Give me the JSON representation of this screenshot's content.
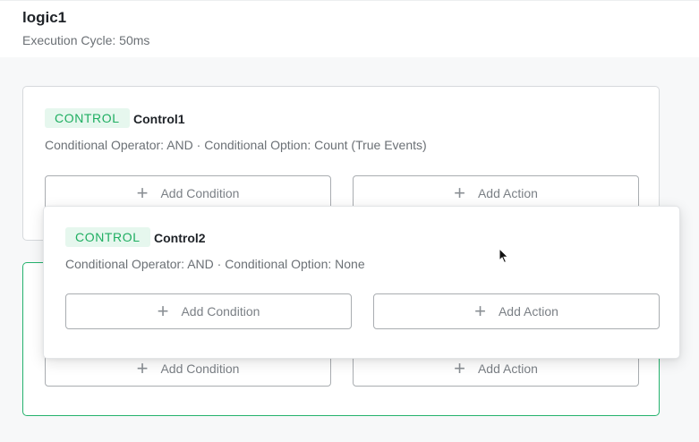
{
  "header": {
    "title": "logic1",
    "subtitle": "Execution Cycle: 50ms"
  },
  "controls": [
    {
      "tag": "CONTROL",
      "name": "Control1",
      "info": "Conditional Operator: AND · Conditional Option: Count (True Events)",
      "add_condition": "Add Condition",
      "add_action": "Add Action"
    },
    {
      "tag": "CONTROL",
      "name": "Control2",
      "info": "Conditional Operator: AND · Conditional Option: None",
      "add_condition": "Add Condition",
      "add_action": "Add Action"
    },
    {
      "add_condition": "Add Condition",
      "add_action": "Add Action"
    }
  ],
  "icons": {
    "plus": "+"
  },
  "colors": {
    "accent": "#25b26d",
    "tag_bg": "#e6f7ee",
    "tag_text": "#1fae61"
  }
}
